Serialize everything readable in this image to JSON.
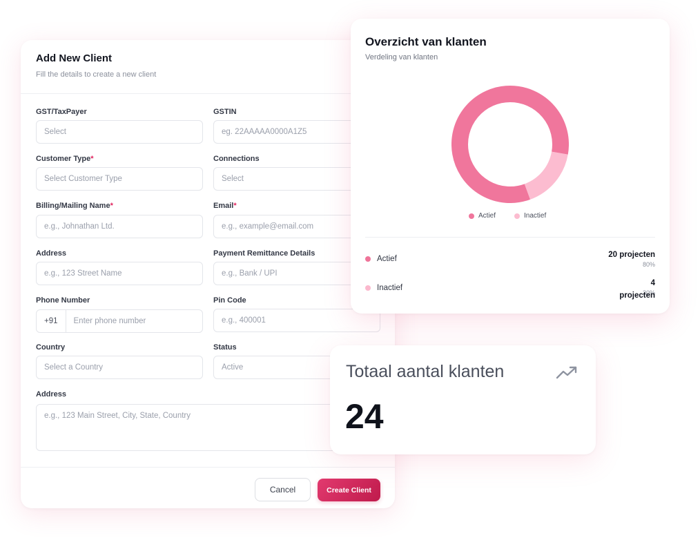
{
  "form": {
    "title": "Add New Client",
    "subtitle": "Fill the details to create a new client",
    "fields": {
      "gst": {
        "label": "GST/TaxPayer",
        "placeholder": "Select"
      },
      "gstin": {
        "label": "GSTIN",
        "placeholder": "eg. 22AAAAA0000A1Z5"
      },
      "customer_type": {
        "label": "Customer Type",
        "placeholder": "Select Customer Type"
      },
      "connections": {
        "label": "Connections",
        "placeholder": "Select"
      },
      "billing_name": {
        "label": "Billing/Mailing Name",
        "placeholder": "e.g., Johnathan Ltd."
      },
      "email": {
        "label": "Email",
        "placeholder": "e.g., example@email.com"
      },
      "address": {
        "label": "Address",
        "placeholder": "e.g., 123 Street Name"
      },
      "payment": {
        "label": "Payment Remittance Details",
        "placeholder": "e.g., Bank / UPI"
      },
      "phone": {
        "label": "Phone Number",
        "prefix": "+91",
        "placeholder": "Enter phone number"
      },
      "pin": {
        "label": "Pin Code",
        "placeholder": "e.g., 400001"
      },
      "country": {
        "label": "Country",
        "placeholder": "Select a Country"
      },
      "status": {
        "label": "Status",
        "value": "Active"
      },
      "full_address": {
        "label": "Address",
        "placeholder": "e.g., 123 Main Street, City, State, Country"
      }
    },
    "required_marker": "*",
    "cancel_label": "Cancel",
    "create_label": "Create Client"
  },
  "overview": {
    "title": "Overzicht van klanten",
    "subtitle": "Verdeling van klanten",
    "rows": [
      {
        "label": "Actief",
        "count": "20 projecten",
        "percent": "80%",
        "color": "#ef7499"
      },
      {
        "label": "Inactief",
        "count": "4 projecten",
        "count_line1": "4",
        "count_line2": "projecten",
        "percent": "20%",
        "color": "#fbb8cd"
      }
    ]
  },
  "chart_data": {
    "type": "pie",
    "title": "Overzicht van klanten",
    "subtitle": "Verdeling van klanten",
    "categories": [
      "Actief",
      "Inactief"
    ],
    "values": [
      20,
      4
    ],
    "colors": [
      "#f0769c",
      "#fcbcd0"
    ],
    "legend": "bottom"
  },
  "total": {
    "title": "Totaal aantal klanten",
    "value": "24",
    "icon": "trending-up-icon"
  }
}
